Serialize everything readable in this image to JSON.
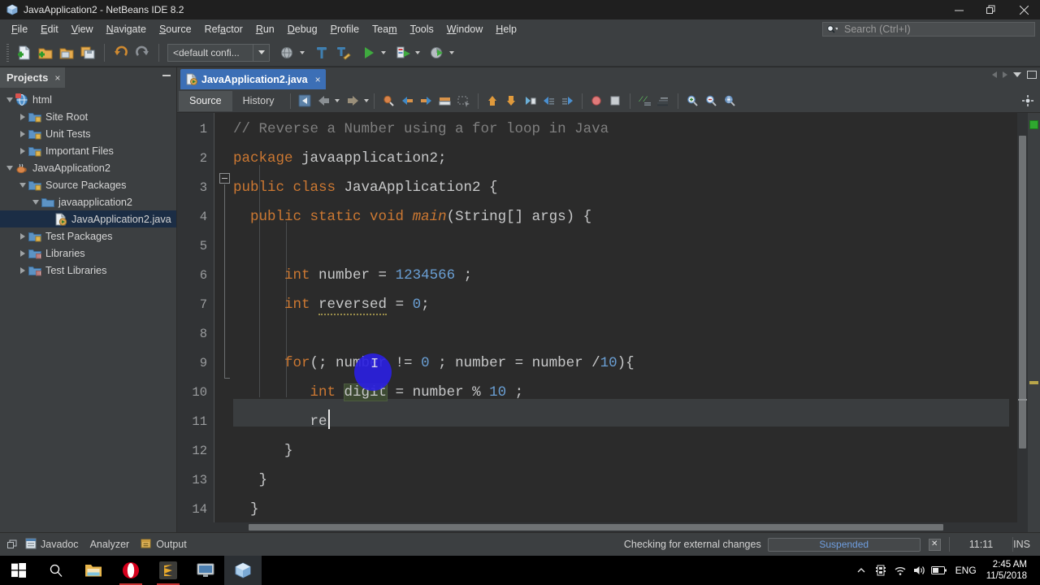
{
  "window": {
    "title": "JavaApplication2 - NetBeans IDE 8.2",
    "app_icon": "netbeans-cube-icon",
    "minimize": "minimize-icon",
    "maximize": "restore-icon",
    "close": "close-icon"
  },
  "menubar": {
    "items": [
      {
        "label": "File",
        "mnemonic": "F"
      },
      {
        "label": "Edit",
        "mnemonic": "E"
      },
      {
        "label": "View",
        "mnemonic": "V"
      },
      {
        "label": "Navigate",
        "mnemonic": "N"
      },
      {
        "label": "Source",
        "mnemonic": "S"
      },
      {
        "label": "Refactor",
        "mnemonic": "a"
      },
      {
        "label": "Run",
        "mnemonic": "R"
      },
      {
        "label": "Debug",
        "mnemonic": "D"
      },
      {
        "label": "Profile",
        "mnemonic": "P"
      },
      {
        "label": "Team",
        "mnemonic": "m"
      },
      {
        "label": "Tools",
        "mnemonic": "T"
      },
      {
        "label": "Window",
        "mnemonic": "W"
      },
      {
        "label": "Help",
        "mnemonic": "H"
      }
    ]
  },
  "search": {
    "placeholder": "Search (Ctrl+I)",
    "icon": "search-icon"
  },
  "toolbar": {
    "config_value": "<default confi...",
    "buttons": [
      {
        "name": "new-file-button",
        "icon": "new-file-icon"
      },
      {
        "name": "new-project-button",
        "icon": "new-project-icon"
      },
      {
        "name": "open-project-button",
        "icon": "open-project-icon"
      },
      {
        "name": "save-all-button",
        "icon": "save-all-icon"
      },
      {
        "name": "undo-button",
        "icon": "undo-icon"
      },
      {
        "name": "redo-button",
        "icon": "redo-icon"
      },
      {
        "name": "build-project-button",
        "icon": "hammer-icon"
      },
      {
        "name": "clean-build-button",
        "icon": "clean-build-icon"
      },
      {
        "name": "run-project-button",
        "icon": "run-play-icon"
      },
      {
        "name": "debug-project-button",
        "icon": "debug-icon"
      },
      {
        "name": "profile-project-button",
        "icon": "profile-icon"
      }
    ]
  },
  "projects": {
    "tab_label": "Projects",
    "close_label": "×",
    "tree": [
      {
        "label": "html",
        "depth": 0,
        "expander": "down",
        "icon": "html-project-icon"
      },
      {
        "label": "Site Root",
        "depth": 1,
        "expander": "right",
        "icon": "folder-badge-icon"
      },
      {
        "label": "Unit Tests",
        "depth": 1,
        "expander": "right",
        "icon": "folder-badge-icon"
      },
      {
        "label": "Important Files",
        "depth": 1,
        "expander": "right",
        "icon": "folder-badge-icon"
      },
      {
        "label": "JavaApplication2",
        "depth": 0,
        "expander": "down",
        "icon": "java-project-icon"
      },
      {
        "label": "Source Packages",
        "depth": 1,
        "expander": "down",
        "icon": "folder-badge-icon"
      },
      {
        "label": "javaapplication2",
        "depth": 2,
        "expander": "down",
        "icon": "package-folder-icon"
      },
      {
        "label": "JavaApplication2.java",
        "depth": 3,
        "expander": "none",
        "icon": "java-file-icon",
        "selected": true
      },
      {
        "label": "Test Packages",
        "depth": 1,
        "expander": "right",
        "icon": "folder-badge-icon"
      },
      {
        "label": "Libraries",
        "depth": 1,
        "expander": "right",
        "icon": "libraries-icon"
      },
      {
        "label": "Test Libraries",
        "depth": 1,
        "expander": "right",
        "icon": "libraries-icon"
      }
    ]
  },
  "editor": {
    "tab": {
      "label": "JavaApplication2.java",
      "icon": "java-file-icon",
      "close": "×"
    },
    "view_tabs": [
      {
        "label": "Source",
        "active": true
      },
      {
        "label": "History",
        "active": false
      }
    ],
    "toolbar_icons": [
      "last-edit-icon",
      "back-icon",
      "forward-icon",
      "find-selection-icon",
      "previous-bookmark-icon",
      "next-bookmark-icon",
      "toggle-bookmark-icon",
      "toggle-rectangular-selection-icon",
      "shift-line-up-icon",
      "shift-line-down-icon",
      "start-macro-recording-icon",
      "previous-error-icon",
      "next-error-icon",
      "stop-macro-icon",
      "stop-icon",
      "comment-icon",
      "uncomment-icon",
      "zoom-in-icon",
      "zoom-out-icon",
      "zoom-reset-icon"
    ],
    "caret_line": 11,
    "lines": [
      {
        "n": 1,
        "indent": 0,
        "tokens": [
          {
            "t": "// Reverse a Number using a for loop in Java",
            "c": "cmt"
          }
        ]
      },
      {
        "n": 2,
        "indent": 0,
        "tokens": [
          {
            "t": "package",
            "c": "kw"
          },
          {
            "t": " javaapplication2;",
            "c": "ident"
          }
        ]
      },
      {
        "n": 3,
        "indent": 0,
        "tokens": [
          {
            "t": "public class",
            "c": "kw"
          },
          {
            "t": " JavaApplication2 {",
            "c": "ident"
          }
        ]
      },
      {
        "n": 4,
        "indent": 0,
        "tokens": [
          {
            "t": "  ",
            "c": "ident"
          },
          {
            "t": "public static void ",
            "c": "kw"
          },
          {
            "t": "main",
            "c": "ital"
          },
          {
            "t": "(String[] args) {",
            "c": "ident"
          }
        ]
      },
      {
        "n": 5,
        "indent": 0,
        "tokens": []
      },
      {
        "n": 6,
        "indent": 0,
        "tokens": [
          {
            "t": "      ",
            "c": "ident"
          },
          {
            "t": "int",
            "c": "kw"
          },
          {
            "t": " number = ",
            "c": "ident"
          },
          {
            "t": "1234566",
            "c": "num"
          },
          {
            "t": " ;",
            "c": "ident"
          }
        ]
      },
      {
        "n": 7,
        "indent": 0,
        "tokens": [
          {
            "t": "      ",
            "c": "ident"
          },
          {
            "t": "int",
            "c": "kw"
          },
          {
            "t": " ",
            "c": "ident"
          },
          {
            "t": "reversed",
            "c": "warnu"
          },
          {
            "t": " = ",
            "c": "ident"
          },
          {
            "t": "0",
            "c": "num"
          },
          {
            "t": ";",
            "c": "ident"
          }
        ]
      },
      {
        "n": 8,
        "indent": 0,
        "tokens": []
      },
      {
        "n": 9,
        "indent": 0,
        "tokens": [
          {
            "t": "      ",
            "c": "ident"
          },
          {
            "t": "for",
            "c": "kw"
          },
          {
            "t": "(; number != ",
            "c": "ident"
          },
          {
            "t": "0",
            "c": "num"
          },
          {
            "t": " ; number = number /",
            "c": "ident"
          },
          {
            "t": "10",
            "c": "num"
          },
          {
            "t": "){",
            "c": "ident"
          }
        ]
      },
      {
        "n": 10,
        "indent": 0,
        "tokens": [
          {
            "t": "         ",
            "c": "ident"
          },
          {
            "t": "int",
            "c": "kw"
          },
          {
            "t": " ",
            "c": "ident"
          },
          {
            "t": "digit",
            "c": "hl-green"
          },
          {
            "t": " = number % ",
            "c": "ident"
          },
          {
            "t": "10",
            "c": "num"
          },
          {
            "t": " ;",
            "c": "ident"
          }
        ]
      },
      {
        "n": 11,
        "indent": 0,
        "tokens": [
          {
            "t": "         re",
            "c": "ident"
          }
        ],
        "caret": true
      },
      {
        "n": 12,
        "indent": 0,
        "tokens": [
          {
            "t": "      }",
            "c": "ident"
          }
        ]
      },
      {
        "n": 13,
        "indent": 0,
        "tokens": [
          {
            "t": "   }",
            "c": "ident"
          }
        ]
      },
      {
        "n": 14,
        "indent": 0,
        "tokens": [
          {
            "t": "  }",
            "c": "ident"
          }
        ]
      }
    ]
  },
  "bottom_tabs": [
    {
      "label": "Javadoc",
      "icon": "javadoc-icon"
    },
    {
      "label": "Analyzer",
      "icon": ""
    },
    {
      "label": "Output",
      "icon": "output-icon"
    }
  ],
  "statusbar": {
    "message": "Checking for external changes",
    "progress_label": "Suspended",
    "cancel_icon": "cancel-task-icon",
    "position": "11:11",
    "insert_mode": "INS"
  },
  "taskbar": {
    "items": [
      {
        "name": "start-button",
        "icon": "windows-logo-icon"
      },
      {
        "name": "taskbar-search",
        "icon": "search-icon"
      },
      {
        "name": "taskbar-file-explorer",
        "icon": "folder-icon"
      },
      {
        "name": "taskbar-opera",
        "icon": "opera-icon"
      },
      {
        "name": "taskbar-sublime-text",
        "icon": "sublime-icon"
      },
      {
        "name": "taskbar-remote-desktop",
        "icon": "monitor-icon"
      },
      {
        "name": "taskbar-netbeans",
        "icon": "netbeans-cube-icon",
        "active": true
      }
    ],
    "tray": {
      "overflow": "chevron-up-icon",
      "icons": [
        "tray-app-icon",
        "wifi-icon",
        "volume-icon",
        "battery-icon"
      ],
      "language": "ENG",
      "time": "2:45 AM",
      "date": "11/5/2018"
    }
  },
  "colors": {
    "accent_tab": "#3c6fb6",
    "keyword": "#cc7832",
    "number": "#6a9fd4",
    "comment": "#7f7f7f",
    "editor_bg": "#2b2b2b",
    "panel_bg": "#3c3f41",
    "selection": "#1b2d45"
  }
}
